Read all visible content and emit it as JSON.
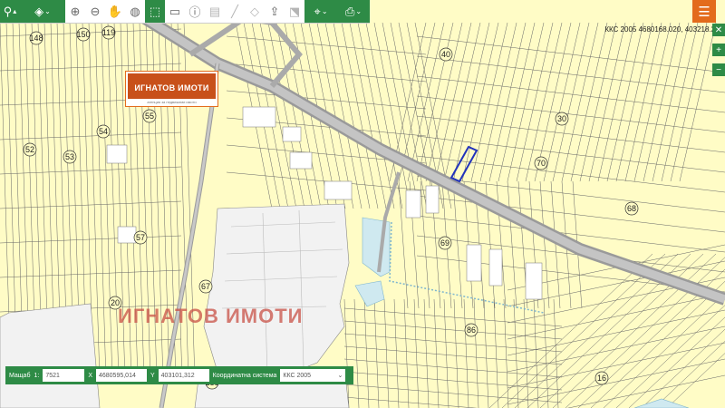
{
  "toolbar": {
    "buttons": [
      {
        "id": "search",
        "icon": "search-icon",
        "glyph": "⚲"
      },
      {
        "id": "layers",
        "icon": "layers-icon",
        "glyph": "◈"
      },
      {
        "id": "zoom-in",
        "icon": "zoom-in-icon",
        "glyph": "⊕"
      },
      {
        "id": "zoom-out",
        "icon": "zoom-out-icon",
        "glyph": "⊖"
      },
      {
        "id": "pan",
        "icon": "hand-icon",
        "glyph": "✋"
      },
      {
        "id": "globe",
        "icon": "globe-icon",
        "glyph": "◍"
      },
      {
        "id": "select",
        "icon": "select-area-icon",
        "glyph": "⬚"
      },
      {
        "id": "deselect",
        "icon": "deselect-icon",
        "glyph": "▭"
      },
      {
        "id": "info",
        "icon": "info-icon",
        "glyph": "ⓘ"
      },
      {
        "id": "report",
        "icon": "document-icon",
        "glyph": "▤"
      },
      {
        "id": "measure",
        "icon": "ruler-icon",
        "glyph": "╱"
      },
      {
        "id": "clear",
        "icon": "eraser-icon",
        "glyph": "◇"
      },
      {
        "id": "upload",
        "icon": "upload-icon",
        "glyph": "⇪"
      },
      {
        "id": "crop",
        "icon": "crop-icon",
        "glyph": "⬔"
      },
      {
        "id": "location",
        "icon": "location-icon",
        "glyph": "⌖"
      },
      {
        "id": "print",
        "icon": "print-icon",
        "glyph": "⎙"
      }
    ]
  },
  "coordinates_readout": "ККС 2005 4680168.020, 403218.255",
  "logo": {
    "text": "ИГНАТОВ ИМОТИ",
    "subtitle": "агенция за недвижими имоти"
  },
  "watermark": "ИГНАТОВ ИМОТИ",
  "bottom_bar": {
    "scale_label": "Мащаб",
    "scale_prefix": "1:",
    "scale_value": "7521",
    "x_label": "X",
    "x_value": "4680595,014",
    "y_label": "Y",
    "y_value": "403101,312",
    "system_label": "Координатна система",
    "system_value": "ККС 2005"
  },
  "plot_labels": [
    "150",
    "119",
    "40",
    "148",
    "55",
    "54",
    "52",
    "53",
    "30",
    "70",
    "68",
    "57",
    "69",
    "67",
    "20",
    "86",
    "16",
    "288"
  ],
  "colors": {
    "accent": "#2e8b46",
    "brand": "#e36b1c",
    "map_bg": "#fffcc6",
    "highlight": "#2233bb"
  }
}
